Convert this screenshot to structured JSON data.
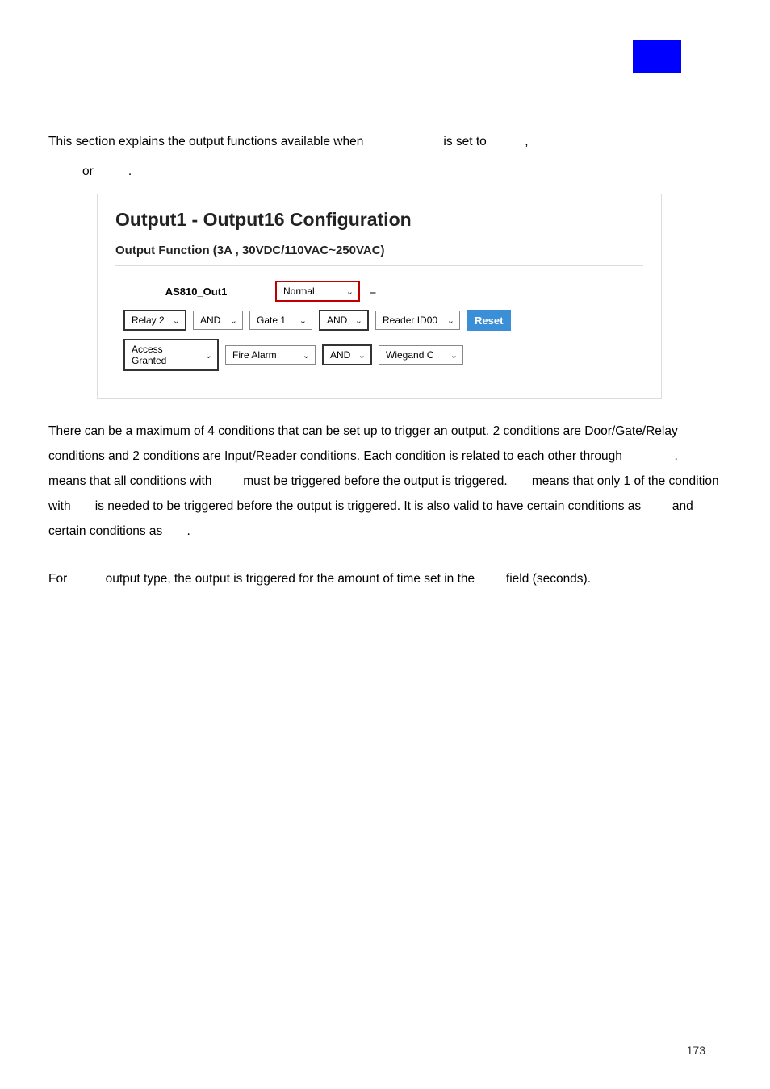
{
  "intro": {
    "line1_a": "This section explains the output functions available when",
    "line1_b": "is set to",
    "line1_c": ",",
    "line2_or": "or",
    "line2_dot": "."
  },
  "panel": {
    "title": "Output1 - Output16 Configuration",
    "subtitle": "Output Function (3A , 30VDC/110VAC~250VAC)",
    "row1": {
      "label": "AS810_Out1",
      "normal": "Normal",
      "equals": "="
    },
    "row2": {
      "relay": "Relay 2",
      "and1": "AND",
      "gate": "Gate 1",
      "and2": "AND",
      "reader": "Reader ID00",
      "reset": "Reset"
    },
    "row3": {
      "access": "Access Granted",
      "fire": "Fire Alarm",
      "and": "AND",
      "wiegand": "Wiegand C"
    }
  },
  "body": {
    "p1_a": "There can be a maximum of 4 conditions that can be set up to trigger an output. 2 conditions are Door/Gate/Relay conditions and 2 conditions are Input/Reader conditions. Each condition is related to each other through",
    "p1_b": ".",
    "p1_c": "means that all conditions with",
    "p1_d": "must be triggered before the output is triggered.",
    "p1_e": "means that only 1 of the condition with",
    "p1_f": "is needed to be triggered before the output is triggered. It is also valid to have certain conditions as",
    "p1_g": "and certain conditions as",
    "p1_h": ".",
    "p2_a": "For",
    "p2_b": "output type, the output is triggered for the amount of time set in the",
    "p2_c": "field (seconds)."
  },
  "page": "173"
}
